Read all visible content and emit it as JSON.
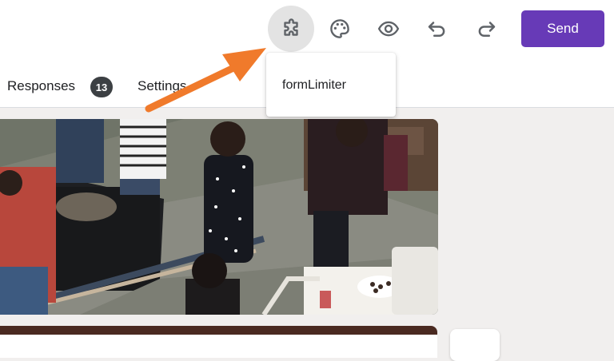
{
  "toolbar": {
    "icons": [
      "puzzle-addons-icon",
      "palette-icon",
      "eye-preview-icon",
      "undo-icon",
      "redo-icon"
    ],
    "send_label": "Send",
    "accent_color": "#673ab7"
  },
  "tabs": {
    "responses_label": "Responses",
    "responses_count": "13",
    "settings_label": "Settings"
  },
  "addons_menu": {
    "items": [
      {
        "label": "formLimiter"
      }
    ]
  },
  "annotation": {
    "color": "#f07a2b"
  },
  "theme": {
    "header_color": "#4a2a21"
  }
}
